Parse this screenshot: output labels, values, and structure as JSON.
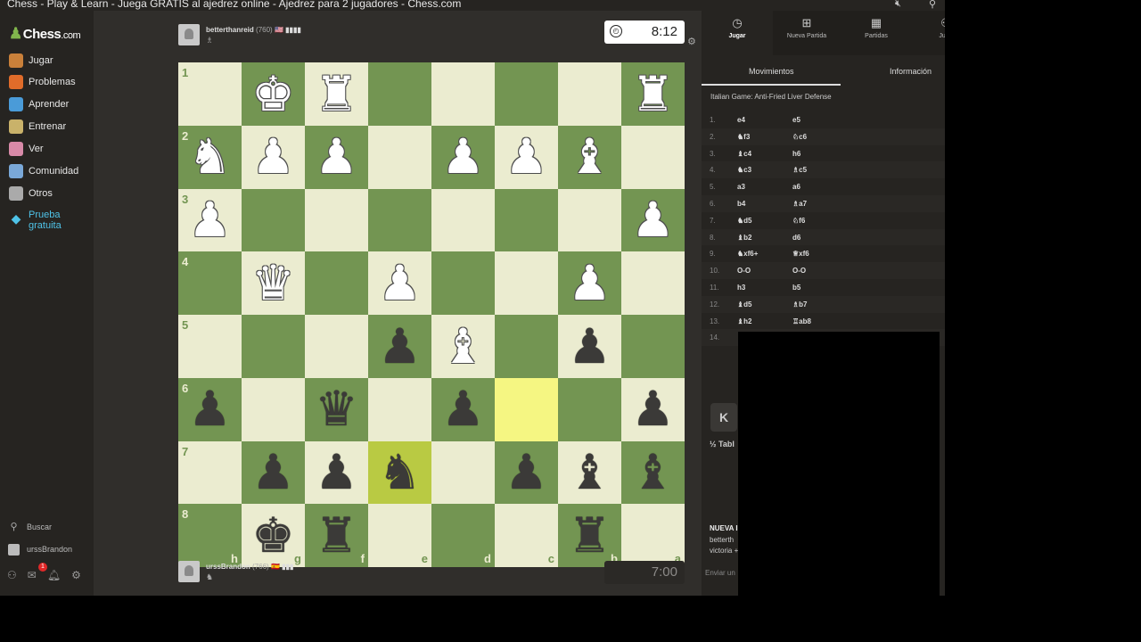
{
  "window": {
    "title": "Chess - Play & Learn - Juega GRATIS al ajedrez online - Ajedrez para 2 jugadores - Chess.com"
  },
  "sidebar": {
    "logo": "Chess",
    "logo_suffix": ".com",
    "items": [
      {
        "label": "Jugar",
        "icon": "play-icon",
        "color": "#c9803a"
      },
      {
        "label": "Problemas",
        "icon": "puzzle-icon",
        "color": "#e06c2a"
      },
      {
        "label": "Aprender",
        "icon": "learn-icon",
        "color": "#4a9bd8"
      },
      {
        "label": "Entrenar",
        "icon": "train-icon",
        "color": "#c9b26a"
      },
      {
        "label": "Ver",
        "icon": "watch-icon",
        "color": "#d88aa8"
      },
      {
        "label": "Comunidad",
        "icon": "community-icon",
        "color": "#7aa8d8"
      },
      {
        "label": "Otros",
        "icon": "more-icon",
        "color": "#aaaaaa"
      }
    ],
    "trial_line1": "Prueba",
    "trial_line2": "gratuita",
    "search": "Buscar",
    "user": "urssBrandon",
    "notifications": "1"
  },
  "top_player": {
    "name": "betterthanreid",
    "rating": "(760)",
    "flag": "🇺🇸 ▮▮▮▮",
    "sub": "♗",
    "clock": "8:12"
  },
  "bottom_player": {
    "name": "urssBrandon",
    "rating": "(766)",
    "flag": "🇪🇸 ▮▮▮",
    "sub": "♞",
    "clock": "7:00"
  },
  "board": {
    "ranks": [
      "1",
      "2",
      "3",
      "4",
      "5",
      "6",
      "7",
      "8"
    ],
    "files": [
      "h",
      "g",
      "f",
      "e",
      "d",
      "c",
      "b",
      "a"
    ],
    "highlight": [
      [
        5,
        5
      ],
      [
        6,
        3
      ]
    ],
    "pieces": [
      [
        "",
        "K",
        "R",
        "",
        "",
        "",
        "",
        "R"
      ],
      [
        "N",
        "P",
        "P",
        "",
        "P",
        "P",
        "B",
        ""
      ],
      [
        "P",
        "",
        "",
        "",
        "",
        "",
        "",
        "P"
      ],
      [
        "",
        "Q",
        "",
        "P",
        "",
        "",
        "P",
        ""
      ],
      [
        "",
        "",
        "",
        "p",
        "B",
        "",
        "p",
        ""
      ],
      [
        "p",
        "",
        "q",
        "",
        "p",
        "",
        "",
        "p"
      ],
      [
        "",
        "p",
        "p",
        "n",
        "",
        "p",
        "b",
        "b"
      ],
      [
        "",
        "k",
        "r",
        "",
        "",
        "",
        "r",
        ""
      ]
    ]
  },
  "right_panel": {
    "top_tabs": [
      {
        "label": "Jugar",
        "icon": "clock-icon",
        "glyph": "◷"
      },
      {
        "label": "Nueva Partida",
        "icon": "plus-icon",
        "glyph": "⊞"
      },
      {
        "label": "Partidas",
        "icon": "board-icon",
        "glyph": "▦"
      },
      {
        "label": "Juga",
        "icon": "players-icon",
        "glyph": "⚇"
      }
    ],
    "sub_tabs": [
      "Movimientos",
      "Información"
    ],
    "opening": "Italian Game: Anti-Fried Liver Defense",
    "moves": [
      {
        "n": "1.",
        "w": "e4",
        "b": "e5"
      },
      {
        "n": "2.",
        "w": "♞f3",
        "b": "♘c6"
      },
      {
        "n": "3.",
        "w": "♝c4",
        "b": "h6"
      },
      {
        "n": "4.",
        "w": "♞c3",
        "b": "♗c5"
      },
      {
        "n": "5.",
        "w": "a3",
        "b": "a6"
      },
      {
        "n": "6.",
        "w": "b4",
        "b": "♗a7"
      },
      {
        "n": "7.",
        "w": "♞d5",
        "b": "♘f6"
      },
      {
        "n": "8.",
        "w": "♝b2",
        "b": "d6"
      },
      {
        "n": "9.",
        "w": "♞xf6+",
        "b": "♕xf6"
      },
      {
        "n": "10.",
        "w": "O-O",
        "b": "O-O"
      },
      {
        "n": "11.",
        "w": "h3",
        "b": "b5"
      },
      {
        "n": "12.",
        "w": "♝d5",
        "b": "♗b7"
      },
      {
        "n": "13.",
        "w": "♝h2",
        "b": "♖ab8"
      },
      {
        "n": "14.",
        "w": "",
        "b": ""
      }
    ],
    "k_button": "K",
    "draw_label": "½ Tabl",
    "chat_new": "NUEVA I",
    "chat_line1": "betterth",
    "chat_line2": "victoria +",
    "chat_placeholder": "Enviar un"
  }
}
